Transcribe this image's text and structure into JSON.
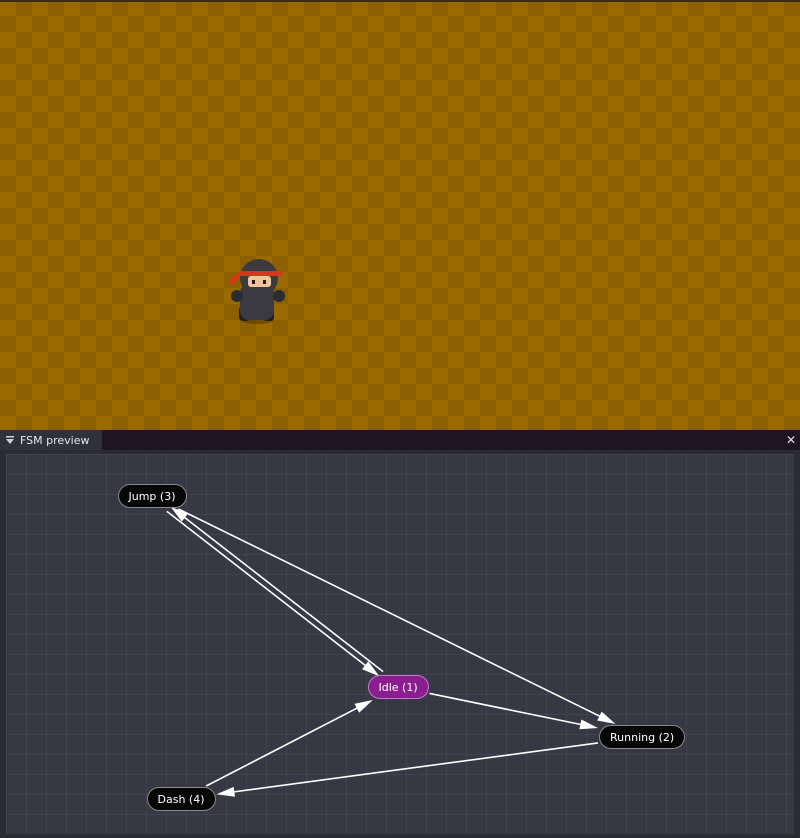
{
  "panel": {
    "title": "FSM preview",
    "close_symbol": "✕"
  },
  "fsm": {
    "nodes": {
      "idle": {
        "label": "Idle (1)",
        "active": true
      },
      "running": {
        "label": "Running (2)",
        "active": false
      },
      "jump": {
        "label": "Jump (3)",
        "active": false
      },
      "dash": {
        "label": "Dash (4)",
        "active": false
      }
    },
    "transitions": [
      {
        "from": "idle",
        "to": "jump"
      },
      {
        "from": "jump",
        "to": "idle"
      },
      {
        "from": "idle",
        "to": "running"
      },
      {
        "from": "jump",
        "to": "running"
      },
      {
        "from": "running",
        "to": "dash"
      },
      {
        "from": "dash",
        "to": "idle"
      }
    ]
  },
  "colors": {
    "active_node": "#8b1e8e",
    "inactive_node": "#070707",
    "edge": "#ffffff"
  }
}
